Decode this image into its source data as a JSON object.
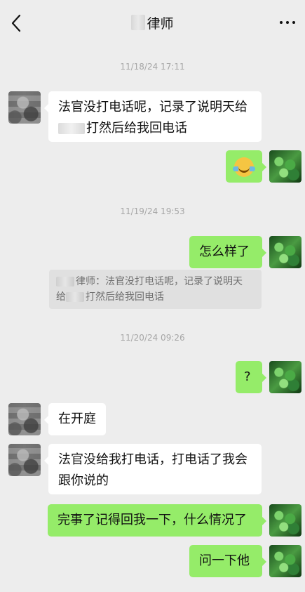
{
  "header": {
    "title": "律师"
  },
  "times": [
    "11/18/24 17:11",
    "11/19/24 19:53",
    "11/20/24 09:26"
  ],
  "messages": [
    {
      "side": "left",
      "text_line1": "法官没打电话呢，记录了说明天给",
      "text_line2": "打然后给我回电话"
    },
    {
      "side": "right",
      "emoji": "laughing-crying-emoji"
    },
    {
      "side": "right",
      "text": "怎么样了"
    },
    {
      "quote_prefix": "律师：法官没打电话呢，记录了说明天",
      "quote_line2": "打然后给我回电话",
      "quote_start": "给"
    },
    {
      "side": "right",
      "text": "?"
    },
    {
      "side": "left",
      "text": "在开庭"
    },
    {
      "side": "left",
      "text_line1": "法官没给我打电话，打电话了我会",
      "text_line2": "跟你说的"
    },
    {
      "side": "right",
      "text": "完事了记得回我一下，什么情况了"
    },
    {
      "side": "right",
      "text": "问一下他"
    }
  ]
}
